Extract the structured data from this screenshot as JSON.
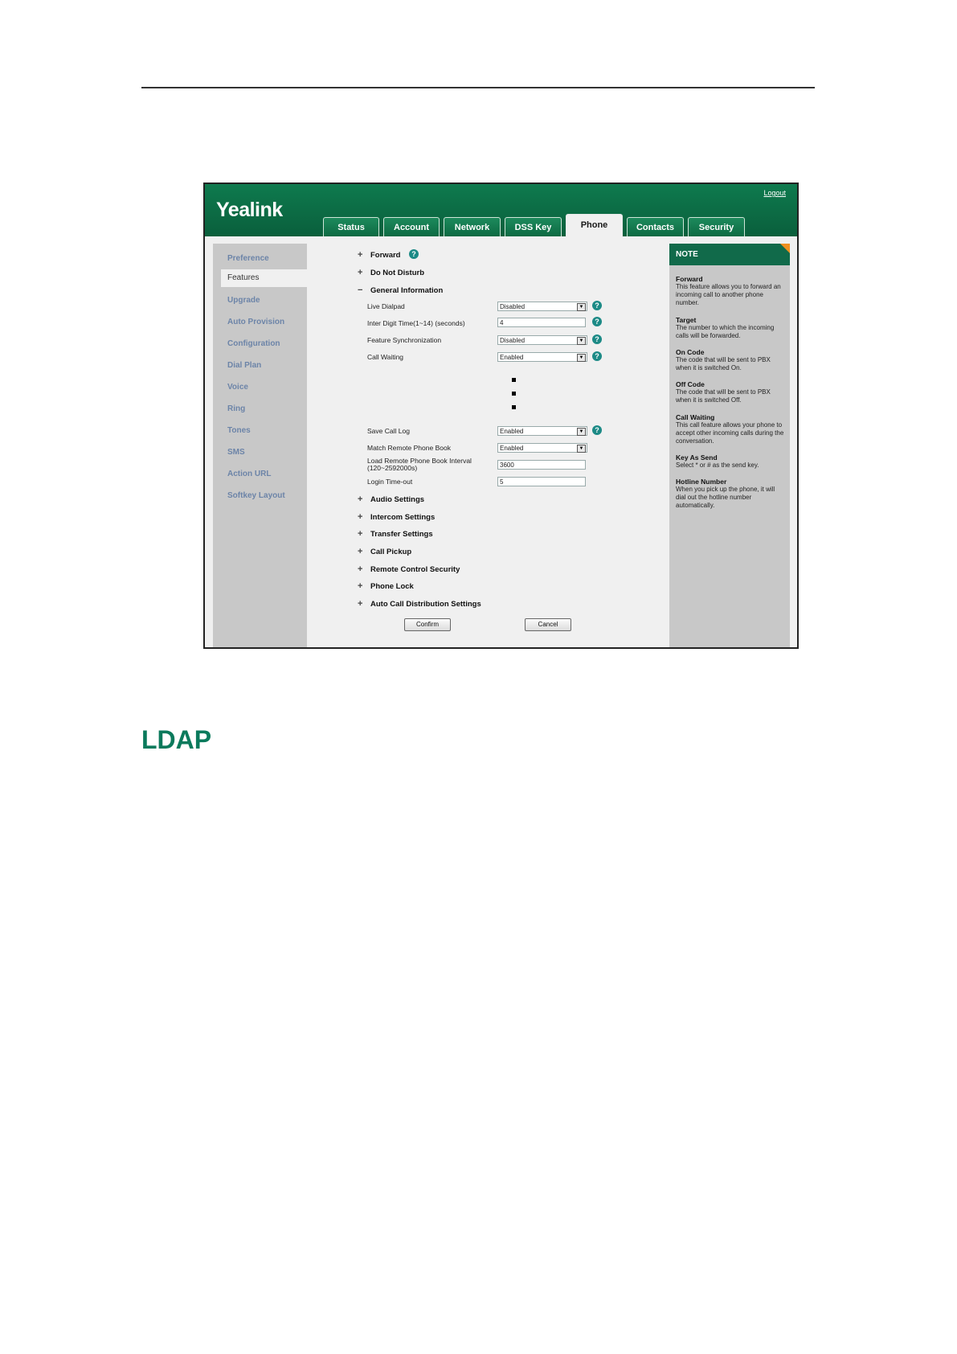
{
  "header": {
    "logo": "Yealink",
    "logout": "Logout",
    "tabs": [
      {
        "label": "Status"
      },
      {
        "label": "Account"
      },
      {
        "label": "Network"
      },
      {
        "label": "DSS Key"
      },
      {
        "label": "Phone",
        "active": true
      },
      {
        "label": "Contacts"
      },
      {
        "label": "Security"
      }
    ]
  },
  "sidebar": {
    "items": [
      {
        "label": "Preference"
      },
      {
        "label": "Features",
        "active": true
      },
      {
        "label": "Upgrade"
      },
      {
        "label": "Auto Provision"
      },
      {
        "label": "Configuration"
      },
      {
        "label": "Dial Plan"
      },
      {
        "label": "Voice"
      },
      {
        "label": "Ring"
      },
      {
        "label": "Tones"
      },
      {
        "label": "SMS"
      },
      {
        "label": "Action URL"
      },
      {
        "label": "Softkey Layout"
      }
    ]
  },
  "main": {
    "sections_top": [
      {
        "label": "Forward",
        "state": "collapsed"
      },
      {
        "label": "Do Not Disturb",
        "state": "collapsed"
      },
      {
        "label": "General Information",
        "state": "expanded"
      }
    ],
    "fields": [
      {
        "label": "Live Dialpad",
        "value": "Disabled",
        "type": "select"
      },
      {
        "label": "Inter Digit Time(1~14) (seconds)",
        "value": "4",
        "type": "text"
      },
      {
        "label": "Feature Synchronization",
        "value": "Disabled",
        "type": "select"
      },
      {
        "label": "Call Waiting",
        "value": "Enabled",
        "type": "select"
      },
      {
        "label": "Save Call Log",
        "value": "Enabled",
        "type": "select"
      },
      {
        "label": "Match Remote Phone Book",
        "value": "Enabled",
        "type": "select"
      },
      {
        "label": "Load Remote Phone Book Interval",
        "label2": "(120~2592000s)",
        "value": "3600",
        "type": "text"
      },
      {
        "label": "Login Time-out",
        "value": "5",
        "type": "text"
      }
    ],
    "sections_bottom": [
      {
        "label": "Audio Settings"
      },
      {
        "label": "Intercom Settings"
      },
      {
        "label": "Transfer Settings"
      },
      {
        "label": "Call Pickup"
      },
      {
        "label": "Remote Control Security"
      },
      {
        "label": "Phone Lock"
      },
      {
        "label": "Auto Call Distribution Settings"
      }
    ],
    "buttons": {
      "confirm": "Confirm",
      "cancel": "Cancel"
    },
    "help_glyph": "?",
    "expand_glyph": "+",
    "collapse_glyph": "−",
    "dropdown_glyph": "▼"
  },
  "note": {
    "title": "NOTE",
    "items": [
      {
        "title": "Forward",
        "text": "This feature allows you to forward an incoming call to another phone number."
      },
      {
        "title": "Target",
        "text": "The number to which the incoming calls will be forwarded."
      },
      {
        "title": "On Code",
        "text": "The code that will be sent to PBX when it is switched On."
      },
      {
        "title": "Off Code",
        "text": "The code that will be sent to PBX when it is switched Off."
      },
      {
        "title": "Call Waiting",
        "text": "This call feature allows your phone to accept other incoming calls during the conversation."
      },
      {
        "title": "Key As Send",
        "text": "Select * or # as the send key."
      },
      {
        "title": "Hotline Number",
        "text": "When you pick up the phone, it will dial out the hotline number automatically."
      }
    ]
  },
  "document": {
    "heading": "LDAP"
  },
  "colors": {
    "brand_green": "#0b6b44",
    "help_teal": "#1c8a86",
    "heading_green": "#0b7a5c",
    "note_corner": "#f09020"
  }
}
